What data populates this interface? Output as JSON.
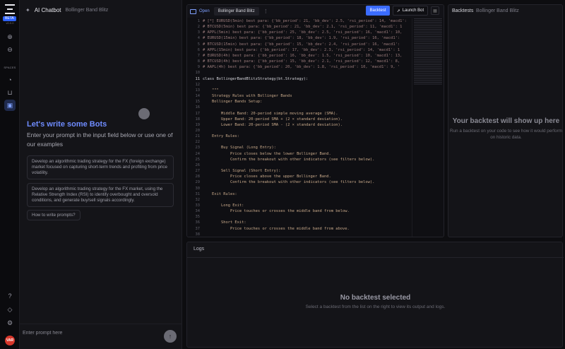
{
  "rail": {
    "version": "v0.0.0",
    "beta": "BETA",
    "spaces_label": "SPACES",
    "avatar": "VAR"
  },
  "chat": {
    "header_title": "AI Chatbot",
    "header_doc": "Bollinger Band Blitz",
    "title": "Let's write some Bots",
    "subtitle": "Enter your prompt in the input field below or use one of our examples",
    "examples": [
      "Develop an algorithmic trading strategy for the FX (foreign exchange) market focused on capturing short-term trends and profiting from price volatility.",
      "Develop an algorithmic trading strategy for the FX market, using the Relative Strength Index (RSI) to identify overbought and oversold conditions, and generate buy/sell signals accordingly."
    ],
    "howto": "How to write prompts?",
    "prompt_placeholder": "Enter prompt here"
  },
  "editor": {
    "open_label": "Open",
    "file_tab": "Bollinger Band Blitz",
    "backtest_btn": "Backtest",
    "launch_btn": "Launch Bot",
    "lines": [
      {
        "n": "1",
        "t": "# [*] EURUSD(5min) best para: {'bb_period': 21, 'bb_dev': 2.5, 'rsi_period': 14, 'macd1':",
        "c": "cm"
      },
      {
        "n": "2",
        "t": "# BTCUSD(5min) best para: {'bb_period': 21, 'bb_dev': 2.1, 'rsi_period': 11, 'macd1': 1",
        "c": "cm"
      },
      {
        "n": "3",
        "t": "# APPL(5min) best para: {'bb_period': 25, 'bb_dev': 2.5, 'rsi_period': 16, 'macd1': 10,",
        "c": "cm"
      },
      {
        "n": "4",
        "t": "# EURUSD(15min) best para: {'bb_period': 18, 'bb_dev': 1.9, 'rsi_period': 16, 'macd1':",
        "c": "cm"
      },
      {
        "n": "5",
        "t": "# BTCUSD(15min) best para: {'bb_period': 15, 'bb_dev': 2.4, 'rsi_period': 16, 'macd1':",
        "c": "cm"
      },
      {
        "n": "6",
        "t": "# APPL(15min) best para: {'bb_period': 17, 'bb_dev': 2.3, 'rsi_period': 14, 'macd1': 1",
        "c": "cm"
      },
      {
        "n": "7",
        "t": "# EURUSD(4h) best para: {'bb_period': 16, 'bb_dev': 1.5, 'rsi_period': 10, 'macd1': 13,",
        "c": "cm"
      },
      {
        "n": "8",
        "t": "# BTCUSD(4h) best para: {'bb_period': 15, 'bb_dev': 2.1, 'rsi_period': 12, 'macd1': 8,",
        "c": "cm"
      },
      {
        "n": "9",
        "t": "# AAPL(4h) best para: {'bb_period': 20, 'bb_dev': 1.8, 'rsi_period': 10, 'macd1': 9, '",
        "c": "cm"
      },
      {
        "n": "10",
        "t": "",
        "c": ""
      },
      {
        "n": "11",
        "t": "class BollingerBandBlitzStrategy(bt.Strategy):",
        "c": "kw"
      },
      {
        "n": "12",
        "t": "",
        "c": ""
      },
      {
        "n": "13",
        "t": "    \"\"\"",
        "c": ""
      },
      {
        "n": "14",
        "t": "    Strategy Rules with Bollinger Bands",
        "c": ""
      },
      {
        "n": "15",
        "t": "    Bollinger Bands Setup:",
        "c": ""
      },
      {
        "n": "16",
        "t": "",
        "c": ""
      },
      {
        "n": "17",
        "t": "        Middle Band: 20-period simple moving average (SMA).",
        "c": ""
      },
      {
        "n": "18",
        "t": "        Upper Band: 20-period SMA + (2 × standard deviation).",
        "c": ""
      },
      {
        "n": "19",
        "t": "        Lower Band: 20-period SMA - (2 × standard deviation).",
        "c": ""
      },
      {
        "n": "20",
        "t": "",
        "c": ""
      },
      {
        "n": "21",
        "t": "    Entry Rules:",
        "c": ""
      },
      {
        "n": "22",
        "t": "",
        "c": ""
      },
      {
        "n": "23",
        "t": "        Buy Signal (Long Entry):",
        "c": ""
      },
      {
        "n": "24",
        "t": "            Price closes below the lower Bollinger Band.",
        "c": ""
      },
      {
        "n": "25",
        "t": "            Confirm the breakout with other indicators (see filters below).",
        "c": ""
      },
      {
        "n": "26",
        "t": "",
        "c": ""
      },
      {
        "n": "27",
        "t": "        Sell Signal (Short Entry):",
        "c": ""
      },
      {
        "n": "28",
        "t": "            Price closes above the upper Bollinger Band.",
        "c": ""
      },
      {
        "n": "29",
        "t": "            Confirm the breakout with other indicators (see filters below).",
        "c": ""
      },
      {
        "n": "30",
        "t": "",
        "c": ""
      },
      {
        "n": "31",
        "t": "    Exit Rules:",
        "c": ""
      },
      {
        "n": "32",
        "t": "",
        "c": ""
      },
      {
        "n": "33",
        "t": "        Long Exit:",
        "c": ""
      },
      {
        "n": "34",
        "t": "            Price touches or crosses the middle band from below.",
        "c": ""
      },
      {
        "n": "35",
        "t": "",
        "c": ""
      },
      {
        "n": "36",
        "t": "        Short Exit:",
        "c": ""
      },
      {
        "n": "37",
        "t": "            Price touches or crosses the middle band from above.",
        "c": ""
      },
      {
        "n": "38",
        "t": "",
        "c": ""
      }
    ]
  },
  "backtests": {
    "title": "Backtests",
    "doc": "Bollinger Band Blitz",
    "empty_title": "Your backtest will show up here",
    "empty_sub": "Run a backtest on your code to see how it would perform on historic data."
  },
  "logs": {
    "title": "Logs",
    "empty_title": "No backtest selected",
    "empty_sub": "Select a backtest from the list on the right to view its output and logs."
  },
  "colors": {
    "accent": "#3b6cff",
    "heading_blue": "#6f8cff",
    "avatar": "#d8372b"
  }
}
